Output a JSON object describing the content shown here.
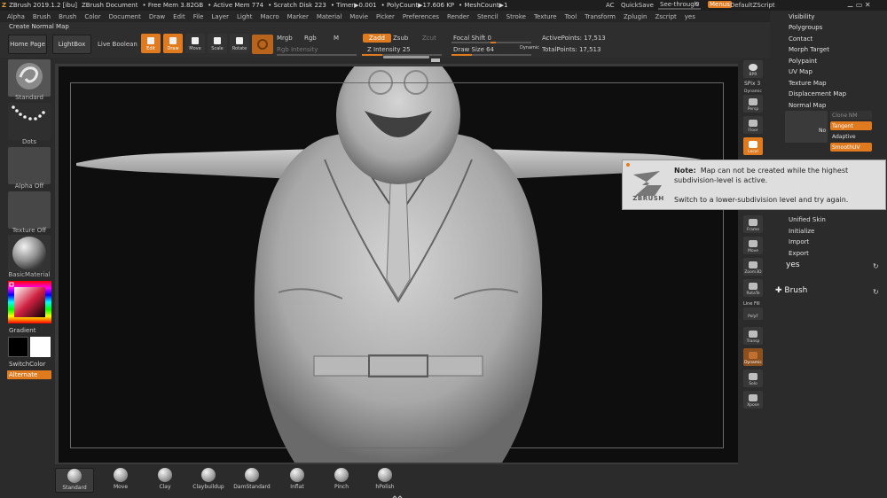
{
  "titlebar": {
    "app": "ZBrush 2019.1.2 [ibu]",
    "document": "ZBrush Document",
    "free_mem": "• Free Mem 3.82GB",
    "active_mem": "• Active Mem 774",
    "scratch": "• Scratch Disk 223",
    "timer": "• Timer▶0.001",
    "polycount": "• PolyCount▶17.606 KP",
    "meshcount": "• MeshCount▶1",
    "ac": "AC",
    "quicksave": "QuickSave",
    "seethrough": "See-through",
    "seethrough_value": "0",
    "see_through_level": 0,
    "menus": "Menus",
    "default_script": "DefaultZScript"
  },
  "menubar": [
    "Alpha",
    "Brush",
    "Brush",
    "Color",
    "Document",
    "Draw",
    "Edit",
    "File",
    "Layer",
    "Light",
    "Macro",
    "Marker",
    "Material",
    "Movie",
    "Picker",
    "Preferences",
    "Render",
    "Stencil",
    "Stroke",
    "Texture",
    "Tool",
    "Transform",
    "Zplugin",
    "Zscript",
    "yes"
  ],
  "shelf": {
    "title": "Create Normal Map",
    "home_page": "Home Page",
    "lightbox": "LightBox",
    "live_boolean": "Live Boolean",
    "edit": "Edit",
    "draw": "Draw",
    "move": "Move",
    "scale": "Scale",
    "rotate": "Rotate",
    "mrgb": "Mrgb",
    "rgb": "Rgb",
    "m": "M",
    "rgb_intensity": "Rgb Intensity",
    "zadd": "Zadd",
    "zsub": "Zsub",
    "zcut": "Zcut",
    "z_intensity": "Z Intensity 25",
    "z_intensity_value": 25,
    "focal_shift": "Focal Shift 0",
    "focal_shift_value": 0,
    "draw_size": "Draw Size 64",
    "draw_size_value": 64,
    "dynamic": "Dynamic",
    "active_points": "ActivePoints: 17,513",
    "total_points": "TotalPoints: 17,513"
  },
  "leftpanel": {
    "standard": "Standard",
    "dots": "Dots",
    "alpha_off": "Alpha Off",
    "texture_off": "Texture Off",
    "material": "BasicMaterial",
    "gradient": "Gradient",
    "switch_color": "SwitchColor",
    "alternate": "Alternate"
  },
  "righttools": {
    "bpr": "BPR",
    "spix": "SPix 3",
    "dynamic": "Dynamic",
    "persp": "Persp",
    "floor": "Floor",
    "local": "Local",
    "frame": "Frame",
    "move": "Move",
    "zoom3d": "Zoom3D",
    "rotate": "RotaTe",
    "line_fill": "Line Fill",
    "polyf": "PolyF",
    "transp": "Transp",
    "dynamic2": "Dynamic",
    "solo": "Solo",
    "xpose": "Xpose"
  },
  "palette": {
    "visibility": "Visibility",
    "polygroups": "Polygroups",
    "contact": "Contact",
    "morph_target": "Morph Target",
    "polypaint": "Polypaint",
    "uv_map": "UV Map",
    "texture_map": "Texture Map",
    "displacement_map": "Displacement Map",
    "normal_map": "Normal Map",
    "clone_nm": "Clone NM",
    "tangent": "Tangent",
    "adaptive": "Adaptive",
    "smoothuv": "SmoothUV",
    "no": "No",
    "unified_skin": "Unified Skin",
    "initialize": "Initialize",
    "import": "Import",
    "export": "Export",
    "yes": "yes",
    "brush": "Brush"
  },
  "note": {
    "label": "Note:",
    "message": "Map can not be created while the highest subdivision-level is active.",
    "hint": "Switch to a lower-subdivision level and try again.",
    "logo": "ZBRUSH"
  },
  "brushes": [
    "Standard",
    "Move",
    "Clay",
    "Claybuildup",
    "DamStandard",
    "Inflat",
    "Pinch",
    "hPolish"
  ],
  "colors": {
    "accent": "#e07a1f",
    "background": "#2b2b2b",
    "canvas": "#0e0e0e"
  }
}
